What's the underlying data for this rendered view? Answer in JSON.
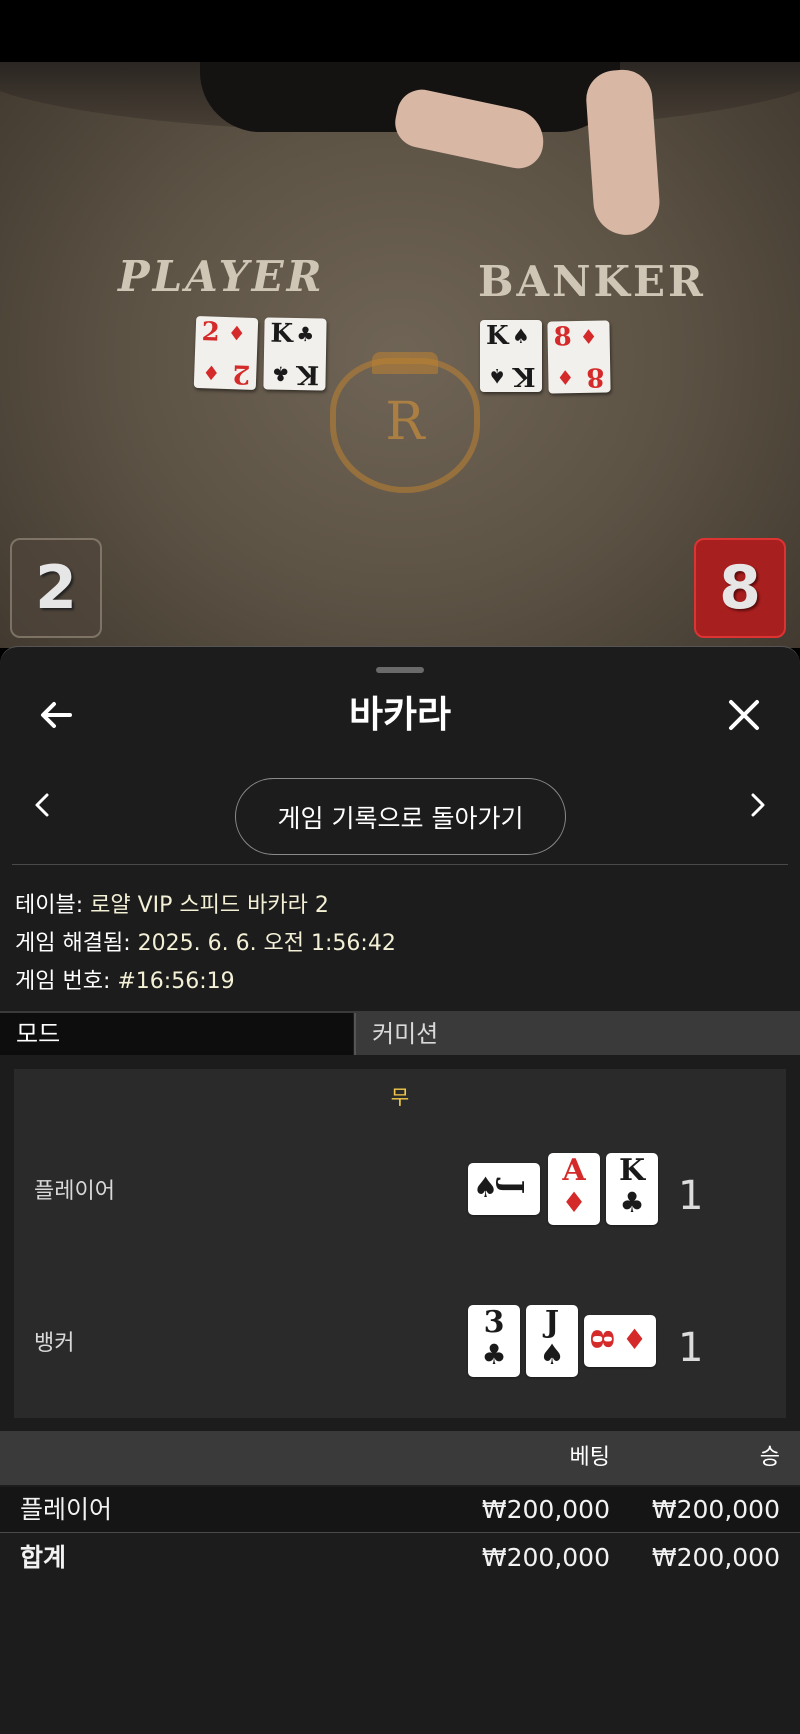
{
  "video": {
    "player_label": "PLAYER",
    "banker_label": "BANKER",
    "crest_letter": "R",
    "player_cards": [
      {
        "rank": "2",
        "suit": "♦",
        "color": "red"
      },
      {
        "rank": "K",
        "suit": "♣",
        "color": "black"
      }
    ],
    "banker_cards": [
      {
        "rank": "K",
        "suit": "♠",
        "color": "black"
      },
      {
        "rank": "8",
        "suit": "♦",
        "color": "red"
      }
    ],
    "player_score": "2",
    "banker_score": "8"
  },
  "panel": {
    "title": "바카라",
    "back_icon": "arrow-left-icon",
    "close_icon": "close-icon",
    "back_to_history": "게임 기록으로 돌아가기",
    "info": {
      "table_key": "테이블:",
      "table_value": "로얄 VIP 스피드 바카라 2",
      "resolved_key": "게임 해결됨:",
      "resolved_value": "2025. 6. 6. 오전 1:56:42",
      "number_key": "게임 번호:",
      "number_value": "#16:56:19"
    },
    "tabs": [
      {
        "label": "모드",
        "active": true
      },
      {
        "label": "커미션",
        "active": false
      }
    ],
    "result": {
      "outcome": "무",
      "player_label": "플레이어",
      "banker_label": "뱅커",
      "player_total": "1",
      "banker_total": "1",
      "player_cards": [
        {
          "rank": "J",
          "suit": "♠",
          "color": "black",
          "orientation": "sideways"
        },
        {
          "rank": "A",
          "suit": "♦",
          "color": "red",
          "orientation": "upright"
        },
        {
          "rank": "K",
          "suit": "♣",
          "color": "black",
          "orientation": "upright"
        }
      ],
      "banker_cards": [
        {
          "rank": "3",
          "suit": "♣",
          "color": "black",
          "orientation": "upright"
        },
        {
          "rank": "J",
          "suit": "♠",
          "color": "black",
          "orientation": "upright"
        },
        {
          "rank": "8",
          "suit": "♦",
          "color": "red",
          "orientation": "sideways"
        }
      ]
    },
    "bets": {
      "header_bet": "베팅",
      "header_win": "승",
      "rows": [
        {
          "name": "플레이어",
          "bet": "₩200,000",
          "win": "₩200,000"
        },
        {
          "name": "합계",
          "bet": "₩200,000",
          "win": "₩200,000"
        }
      ]
    }
  },
  "colors": {
    "panel_bg": "#1c1c1c",
    "outcome_yellow": "#f2c94c",
    "banker_red": "#a81f1f",
    "card_red": "#d42a2a"
  }
}
